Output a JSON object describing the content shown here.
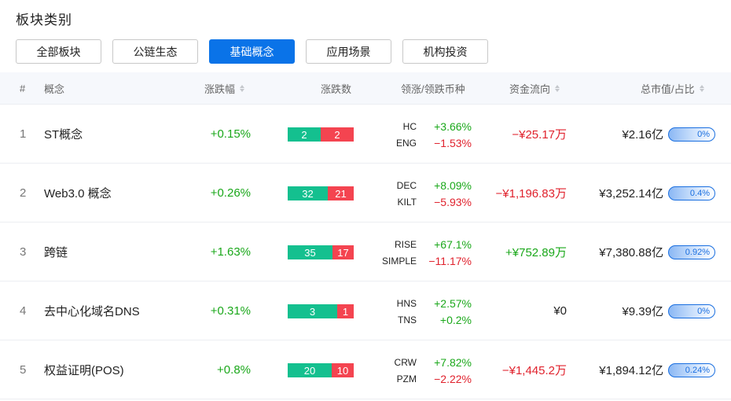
{
  "title": "板块类别",
  "tabs": [
    {
      "label": "全部板块",
      "active": false
    },
    {
      "label": "公链生态",
      "active": false
    },
    {
      "label": "基础概念",
      "active": true
    },
    {
      "label": "应用场景",
      "active": false
    },
    {
      "label": "机构投资",
      "active": false
    }
  ],
  "columns": {
    "index": "#",
    "concept": "概念",
    "change": "涨跌幅",
    "up_down_count": "涨跌数",
    "leaders": "领涨/领跌币种",
    "fund_flow": "资金流向",
    "market_cap": "总市值/占比"
  },
  "colors": {
    "accent": "#0a73e8",
    "up": "#1ba81b",
    "down": "#e0222d",
    "bar_up": "#14c08f",
    "bar_down": "#f44450"
  },
  "rows": [
    {
      "index": "1",
      "name": "ST概念",
      "change": "+0.15%",
      "change_dir": "up",
      "up_count": 2,
      "down_count": 2,
      "leaders": [
        {
          "symbol": "HC",
          "pct": "+3.66%",
          "dir": "up"
        },
        {
          "symbol": "ENG",
          "pct": "−1.53%",
          "dir": "down"
        }
      ],
      "flow": "−¥25.17万",
      "flow_dir": "down",
      "market_cap": "¥2.16亿",
      "share": "0%"
    },
    {
      "index": "2",
      "name": "Web3.0 概念",
      "change": "+0.26%",
      "change_dir": "up",
      "up_count": 32,
      "down_count": 21,
      "leaders": [
        {
          "symbol": "DEC",
          "pct": "+8.09%",
          "dir": "up"
        },
        {
          "symbol": "KILT",
          "pct": "−5.93%",
          "dir": "down"
        }
      ],
      "flow": "−¥1,196.83万",
      "flow_dir": "down",
      "market_cap": "¥3,252.14亿",
      "share": "0.4%"
    },
    {
      "index": "3",
      "name": "跨链",
      "change": "+1.63%",
      "change_dir": "up",
      "up_count": 35,
      "down_count": 17,
      "leaders": [
        {
          "symbol": "RISE",
          "pct": "+67.1%",
          "dir": "up"
        },
        {
          "symbol": "SIMPLE",
          "pct": "−11.17%",
          "dir": "down"
        }
      ],
      "flow": "+¥752.89万",
      "flow_dir": "up",
      "market_cap": "¥7,380.88亿",
      "share": "0.92%"
    },
    {
      "index": "4",
      "name": "去中心化域名DNS",
      "change": "+0.31%",
      "change_dir": "up",
      "up_count": 3,
      "down_count": 1,
      "leaders": [
        {
          "symbol": "HNS",
          "pct": "+2.57%",
          "dir": "up"
        },
        {
          "symbol": "TNS",
          "pct": "+0.2%",
          "dir": "up"
        }
      ],
      "flow": "¥0",
      "flow_dir": "neutral",
      "market_cap": "¥9.39亿",
      "share": "0%"
    },
    {
      "index": "5",
      "name": "权益证明(POS)",
      "change": "+0.8%",
      "change_dir": "up",
      "up_count": 20,
      "down_count": 10,
      "leaders": [
        {
          "symbol": "CRW",
          "pct": "+7.82%",
          "dir": "up"
        },
        {
          "symbol": "PZM",
          "pct": "−2.22%",
          "dir": "down"
        }
      ],
      "flow": "−¥1,445.2万",
      "flow_dir": "down",
      "market_cap": "¥1,894.12亿",
      "share": "0.24%"
    }
  ]
}
